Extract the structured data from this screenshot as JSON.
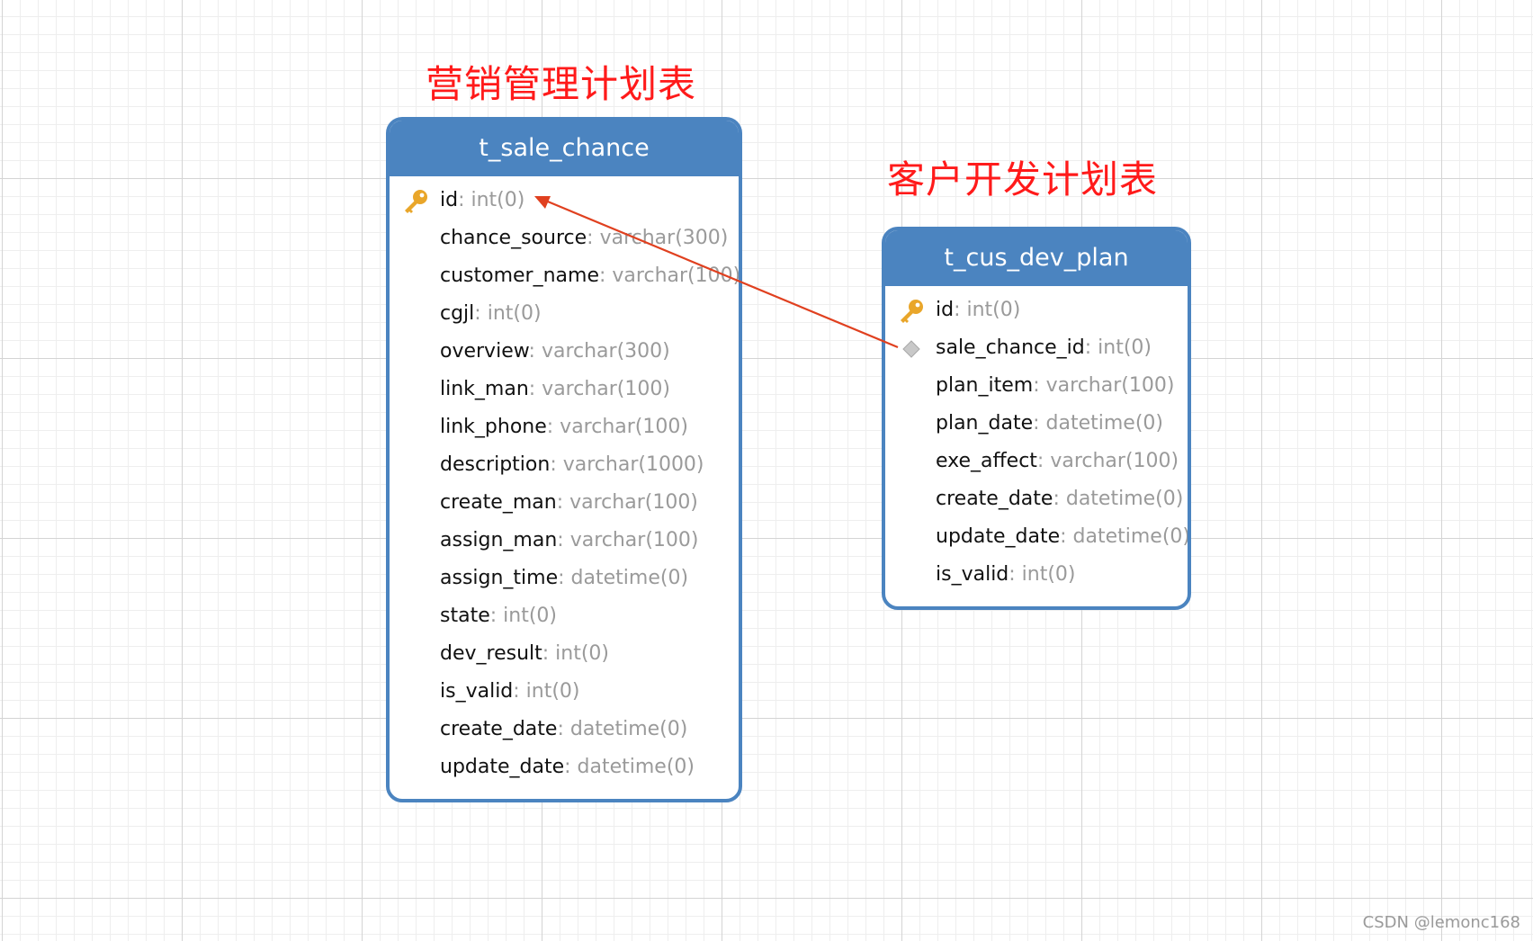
{
  "annotations": {
    "sale_chance_note": "营销管理计划表",
    "cus_dev_plan_note": "客户开发计划表"
  },
  "tables": {
    "sale_chance": {
      "name": "t_sale_chance",
      "columns": [
        {
          "name": "id",
          "type": "int(0)",
          "key": "primary"
        },
        {
          "name": "chance_source",
          "type": "varchar(300)"
        },
        {
          "name": "customer_name",
          "type": "varchar(100)"
        },
        {
          "name": "cgjl",
          "type": "int(0)"
        },
        {
          "name": "overview",
          "type": "varchar(300)"
        },
        {
          "name": "link_man",
          "type": "varchar(100)"
        },
        {
          "name": "link_phone",
          "type": "varchar(100)"
        },
        {
          "name": "description",
          "type": "varchar(1000)"
        },
        {
          "name": "create_man",
          "type": "varchar(100)"
        },
        {
          "name": "assign_man",
          "type": "varchar(100)"
        },
        {
          "name": "assign_time",
          "type": "datetime(0)"
        },
        {
          "name": "state",
          "type": "int(0)"
        },
        {
          "name": "dev_result",
          "type": "int(0)"
        },
        {
          "name": "is_valid",
          "type": "int(0)"
        },
        {
          "name": "create_date",
          "type": "datetime(0)"
        },
        {
          "name": "update_date",
          "type": "datetime(0)"
        }
      ]
    },
    "cus_dev_plan": {
      "name": "t_cus_dev_plan",
      "columns": [
        {
          "name": "id",
          "type": "int(0)",
          "key": "primary"
        },
        {
          "name": "sale_chance_id",
          "type": "int(0)",
          "key": "foreign"
        },
        {
          "name": "plan_item",
          "type": "varchar(100)"
        },
        {
          "name": "plan_date",
          "type": "datetime(0)"
        },
        {
          "name": "exe_affect",
          "type": "varchar(100)"
        },
        {
          "name": "create_date",
          "type": "datetime(0)"
        },
        {
          "name": "update_date",
          "type": "datetime(0)"
        },
        {
          "name": "is_valid",
          "type": "int(0)"
        }
      ]
    }
  },
  "relation": {
    "from": "t_cus_dev_plan.sale_chance_id",
    "to": "t_sale_chance.id",
    "color": "#e0401f"
  },
  "colors": {
    "header": "#4b84c0",
    "annotation": "#ff1a1a",
    "column_name": "#111111",
    "column_type": "#9a9a9a",
    "key_icon": "#e9a62a",
    "foreign_key_icon": "#c8c8c8"
  },
  "icons": {
    "primary": "key-icon",
    "foreign": "diamond-icon"
  },
  "watermark": "CSDN @lemonc168"
}
